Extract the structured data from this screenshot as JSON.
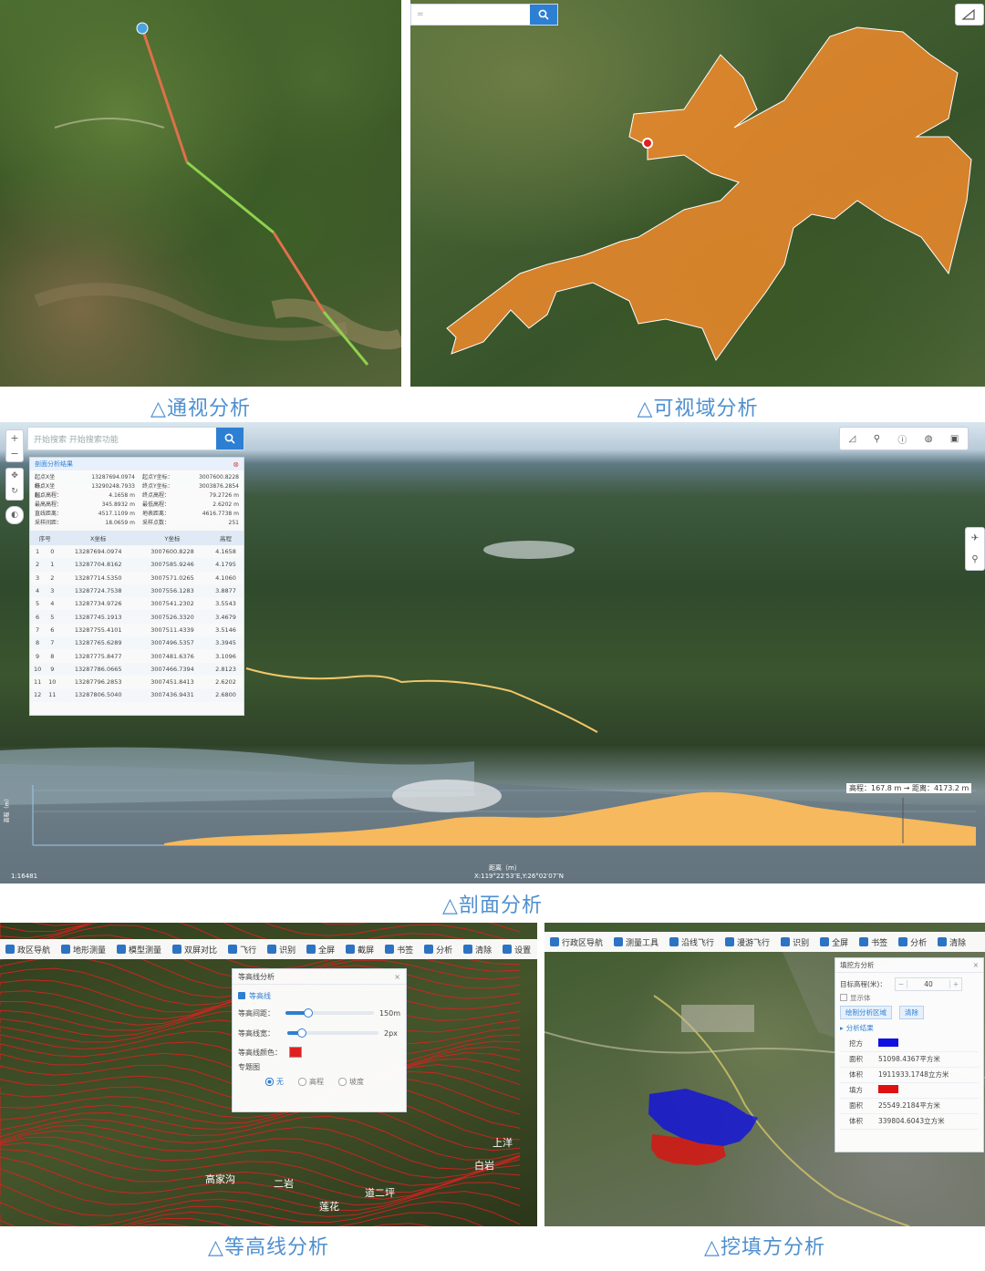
{
  "captions": {
    "p1": "△通视分析",
    "p2": "△可视域分析",
    "p3": "△剖面分析",
    "p4": "△等高线分析",
    "p5": "△挖填方分析"
  },
  "colors": {
    "caption": "#4f8fcf",
    "accent": "#2d7fd3",
    "visible": "#8fd14f",
    "invisible": "#e0704a",
    "viewshed": "#f08a2c",
    "profile_fill": "#f6b95e",
    "contour": "#e02020",
    "cut": "#1010e0",
    "fill": "#e01010"
  },
  "profile": {
    "search_placeholder": "开始搜索 开始搜索功能",
    "panel_title": "剖面分析结果",
    "summary": [
      {
        "k1": "起点X坐标：",
        "v1": "13287694.0974",
        "k2": "起点Y坐标：",
        "v2": "3007600.8228"
      },
      {
        "k1": "终点X坐标：",
        "v1": "13290248.7933",
        "k2": "终点Y坐标：",
        "v2": "3003876.2854"
      },
      {
        "k1": "起点高程：",
        "v1": "4.1658 m",
        "k2": "终点高程：",
        "v2": "79.2726 m"
      },
      {
        "k1": "最高高程：",
        "v1": "345.8932 m",
        "k2": "最低高程：",
        "v2": "2.6202 m"
      },
      {
        "k1": "直线距离：",
        "v1": "4517.1109 m",
        "k2": "地表距离：",
        "v2": "4616.7738 m"
      },
      {
        "k1": "采样间距：",
        "v1": "18.0659 m",
        "k2": "采样点数：",
        "v2": "251"
      }
    ],
    "columns": [
      "序号",
      "X坐标",
      "Y坐标",
      "高程"
    ],
    "rows": [
      [
        "1",
        "0",
        "13287694.0974",
        "3007600.8228",
        "4.1658"
      ],
      [
        "2",
        "1",
        "13287704.8162",
        "3007585.9246",
        "4.1795"
      ],
      [
        "3",
        "2",
        "13287714.5350",
        "3007571.0265",
        "4.1060"
      ],
      [
        "4",
        "3",
        "13287724.7538",
        "3007556.1283",
        "3.8877"
      ],
      [
        "5",
        "4",
        "13287734.9726",
        "3007541.2302",
        "3.5543"
      ],
      [
        "6",
        "5",
        "13287745.1913",
        "3007526.3320",
        "3.4679"
      ],
      [
        "7",
        "6",
        "13287755.4101",
        "3007511.4339",
        "3.5146"
      ],
      [
        "8",
        "7",
        "13287765.6289",
        "3007496.5357",
        "3.3945"
      ],
      [
        "9",
        "8",
        "13287775.8477",
        "3007481.6376",
        "3.1096"
      ],
      [
        "10",
        "9",
        "13287786.0665",
        "3007466.7394",
        "2.8123"
      ],
      [
        "11",
        "10",
        "13287796.2853",
        "3007451.8413",
        "2.6202"
      ],
      [
        "12",
        "11",
        "13287806.5040",
        "3007436.9431",
        "2.6800"
      ]
    ],
    "chart_label": "高程：167.8 m → 距离：4173.2 m",
    "chart_xlabel": "距离（m）",
    "chart_ylabel": "高程（m）",
    "coords": "X:119°22′53″E,Y:26°02′07″N",
    "scale": "1:16481"
  },
  "contour": {
    "toolbar": [
      "政区导航",
      "地形测量",
      "模型测量",
      "双屏对比",
      "飞行",
      "识别",
      "全屏",
      "截屏",
      "书签",
      "分析",
      "清除",
      "设置"
    ],
    "panel_title": "等高线分析",
    "checkbox_label": "等高线",
    "interval_label": "等高间距：",
    "interval_value": "150m",
    "interval_level": 0.24,
    "width_label": "等高线宽：",
    "width_value": "2px",
    "width_level": 0.15,
    "color_label": "等高线颜色：",
    "theme_label": "专题图",
    "theme_options": [
      "无",
      "高程",
      "坡度"
    ],
    "theme_selected": "无",
    "map_labels": [
      "二岩",
      "道二坪",
      "莲花",
      "白岩",
      "高家沟",
      "上洋"
    ]
  },
  "cutfill": {
    "toolbar": [
      "行政区导航",
      "测量工具",
      "沿线飞行",
      "漫游飞行",
      "识别",
      "全屏",
      "书签",
      "分析",
      "清除"
    ],
    "panel_title": "填挖方分析",
    "target_label": "目标高程(米)：",
    "target_value": "40",
    "show_label": "显示体",
    "draw_button": "绘制分析区域",
    "clear_button": "清除",
    "result_title": "分析结果",
    "rows": [
      {
        "k": "挖方",
        "v": ""
      },
      {
        "k": "面积",
        "v": "51098.4367平方米"
      },
      {
        "k": "体积",
        "v": "1911933.1748立方米"
      },
      {
        "k": "填方",
        "v": ""
      },
      {
        "k": "面积",
        "v": "25549.2184平方米"
      },
      {
        "k": "体积",
        "v": "339804.6043立方米"
      }
    ]
  }
}
